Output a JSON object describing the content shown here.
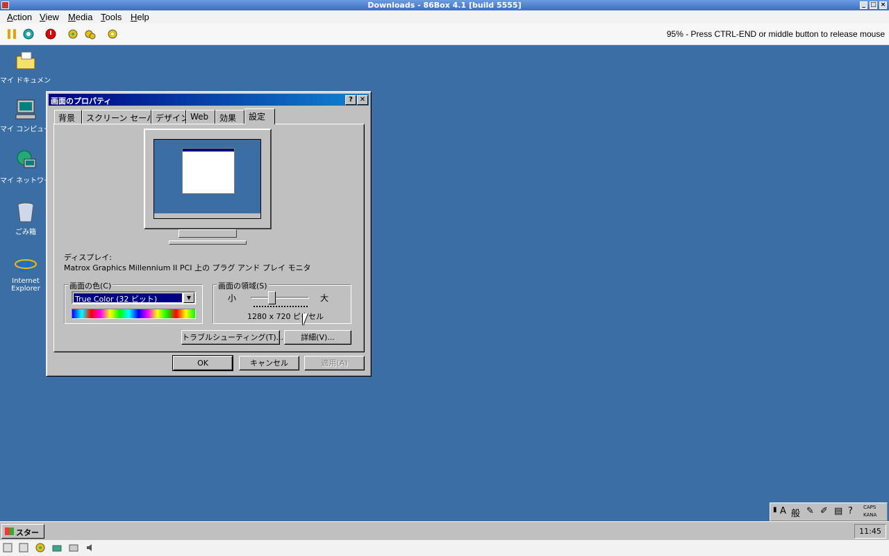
{
  "host": {
    "title": "Downloads - 86Box 4.1 [build 5555]",
    "menu": [
      "Action",
      "View",
      "Media",
      "Tools",
      "Help"
    ],
    "status_message": "95% - Press CTRL-END or middle button to release mouse"
  },
  "desktop": {
    "icons": [
      {
        "label": "マイ ドキュメント",
        "icon": "folder-icon"
      },
      {
        "label": "マイ コンピュータ",
        "icon": "computer-icon"
      },
      {
        "label": "マイ ネットワーク",
        "icon": "network-icon"
      },
      {
        "label": "ごみ箱",
        "icon": "recycle-bin-icon"
      },
      {
        "label": "Internet Explorer",
        "icon": "internet-explorer-icon"
      }
    ]
  },
  "dialog": {
    "title": "画面のプロパティ",
    "help_button": "?",
    "close_button": "✕",
    "tabs": [
      "背景",
      "スクリーン セーバー",
      "デザイン",
      "Web",
      "効果",
      "設定"
    ],
    "active_tab": "設定",
    "display_label": "ディスプレイ:",
    "display_name": "Matrox Graphics Millennium II PCI 上の プラグ アンド プレイ モニタ",
    "colors": {
      "label": "画面の色(C)",
      "selected": "True Color (32 ビット)"
    },
    "area": {
      "label": "画面の領域(S)",
      "min_label": "小",
      "max_label": "大",
      "resolution": "1280 x 720 ピクセル"
    },
    "troubleshoot_button": "トラブルシューティング(T)...",
    "advanced_button": "詳細(V)...",
    "ok_button": "OK",
    "cancel_button": "キャンセル",
    "apply_button": "適用(A)"
  },
  "taskbar": {
    "start_label": "スタート",
    "clock": "11:45",
    "ime": {
      "mode": "般",
      "caps": "CAPS",
      "kana": "KANA"
    }
  }
}
